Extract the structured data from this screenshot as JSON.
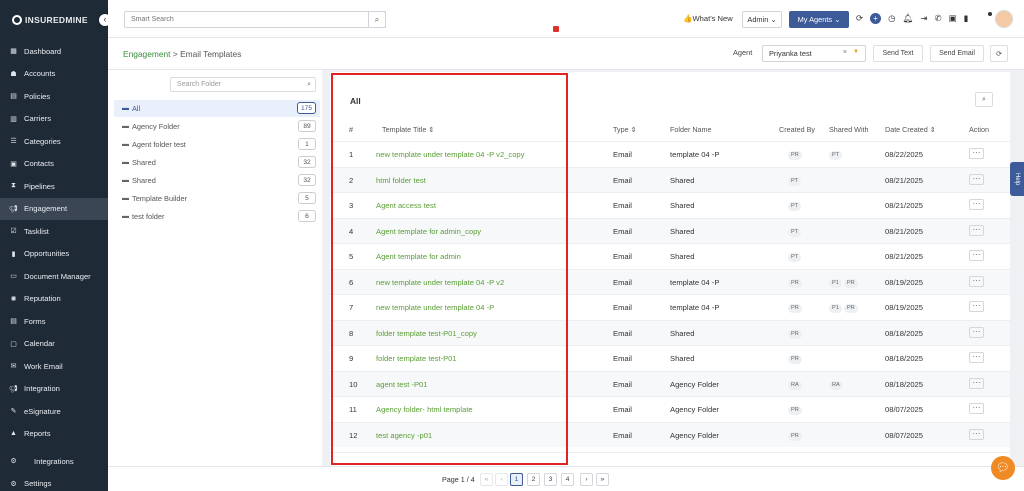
{
  "brand": {
    "logo_text": "INSUREDMINE"
  },
  "sidebar": {
    "collapse_icon": "chevron-left-icon",
    "items": [
      {
        "label": "Dashboard",
        "icon": "dashboard-icon"
      },
      {
        "label": "Accounts",
        "icon": "accounts-icon"
      },
      {
        "label": "Policies",
        "icon": "policies-icon"
      },
      {
        "label": "Carriers",
        "icon": "carriers-icon"
      },
      {
        "label": "Categories",
        "icon": "categories-icon"
      },
      {
        "label": "Contacts",
        "icon": "contacts-icon"
      },
      {
        "label": "Pipelines",
        "icon": "pipelines-icon"
      },
      {
        "label": "Engagement",
        "icon": "megaphone-icon",
        "active": true
      },
      {
        "label": "Tasklist",
        "icon": "tasklist-icon"
      },
      {
        "label": "Opportunities",
        "icon": "bar-chart-icon"
      },
      {
        "label": "Document Manager",
        "icon": "folder-icon"
      },
      {
        "label": "Reputation",
        "icon": "reputation-icon"
      },
      {
        "label": "Forms",
        "icon": "forms-icon"
      },
      {
        "label": "Calendar",
        "icon": "calendar-icon"
      },
      {
        "label": "Work Email",
        "icon": "email-icon"
      },
      {
        "label": "Integration",
        "icon": "megaphone-icon"
      },
      {
        "label": "eSignature",
        "icon": "signature-icon"
      },
      {
        "label": "Reports",
        "icon": "reports-icon"
      },
      {
        "label": "Integrations",
        "icon": "gears-icon"
      },
      {
        "label": "Settings",
        "icon": "gear-icon"
      }
    ]
  },
  "topbar": {
    "search_placeholder": "Smart Search",
    "whats_new": "What's New",
    "admin_label": "Admin",
    "my_agents_label": "My Agents"
  },
  "breadcrumb": {
    "parent": "Engagement",
    "separator": ">",
    "current": "Email Templates"
  },
  "agent": {
    "label": "Agent",
    "selected": "Priyanka test",
    "send_text_label": "Send Text",
    "send_email_label": "Send Email"
  },
  "folders": {
    "search_placeholder": "Search Folder",
    "items": [
      {
        "name": "All",
        "count": "175",
        "selected": true
      },
      {
        "name": "Agency Folder",
        "count": "89"
      },
      {
        "name": "Agent folder test",
        "count": "1"
      },
      {
        "name": "Shared",
        "count": "32"
      },
      {
        "name": "Shared",
        "count": "32"
      },
      {
        "name": "Template Builder",
        "count": "5"
      },
      {
        "name": "test folder",
        "count": "6"
      }
    ]
  },
  "table": {
    "title": "All",
    "columns": {
      "num": "#",
      "title": "Template Title",
      "type": "Type",
      "folder": "Folder Name",
      "created_by": "Created By",
      "shared_with": "Shared With",
      "date": "Date Created",
      "action": "Action"
    },
    "rows": [
      {
        "num": "1",
        "title": "new template under template 04 -P v2_copy",
        "type": "Email",
        "folder": "template 04 -P",
        "created_by": "PR",
        "shared_with": "PT",
        "date": "08/22/2025"
      },
      {
        "num": "2",
        "title": "html folder test",
        "type": "Email",
        "folder": "Shared",
        "created_by": "PT",
        "shared_with": "",
        "date": "08/21/2025"
      },
      {
        "num": "3",
        "title": "Agent access test",
        "type": "Email",
        "folder": "Shared",
        "created_by": "PT",
        "shared_with": "",
        "date": "08/21/2025"
      },
      {
        "num": "4",
        "title": "Agent template for admin_copy",
        "type": "Email",
        "folder": "Shared",
        "created_by": "PT",
        "shared_with": "",
        "date": "08/21/2025"
      },
      {
        "num": "5",
        "title": "Agent template for admin",
        "type": "Email",
        "folder": "Shared",
        "created_by": "PT",
        "shared_with": "",
        "date": "08/21/2025"
      },
      {
        "num": "6",
        "title": "new template under template 04 -P v2",
        "type": "Email",
        "folder": "template 04 -P",
        "created_by": "PR",
        "shared_with": "P1 PR",
        "date": "08/19/2025"
      },
      {
        "num": "7",
        "title": "new template under template 04 -P",
        "type": "Email",
        "folder": "template 04 -P",
        "created_by": "PR",
        "shared_with": "P1 PR",
        "date": "08/19/2025"
      },
      {
        "num": "8",
        "title": "folder template test-P01_copy",
        "type": "Email",
        "folder": "Shared",
        "created_by": "PR",
        "shared_with": "",
        "date": "08/18/2025"
      },
      {
        "num": "9",
        "title": "folder template test-P01",
        "type": "Email",
        "folder": "Shared",
        "created_by": "PR",
        "shared_with": "",
        "date": "08/18/2025"
      },
      {
        "num": "10",
        "title": "agent test -P01",
        "type": "Email",
        "folder": "Agency Folder",
        "created_by": "RA",
        "shared_with": "RA",
        "date": "08/18/2025"
      },
      {
        "num": "11",
        "title": "Agency folder- html template",
        "type": "Email",
        "folder": "Agency Folder",
        "created_by": "PR",
        "shared_with": "",
        "date": "08/07/2025"
      },
      {
        "num": "12",
        "title": "test agency -p01",
        "type": "Email",
        "folder": "Agency Folder",
        "created_by": "PR",
        "shared_with": "",
        "date": "08/07/2025"
      }
    ],
    "row_action_label": "···"
  },
  "pagination": {
    "page_text": "Page 1 / 4",
    "first": "«",
    "prev": "‹",
    "pages": [
      "1",
      "2",
      "3",
      "4"
    ],
    "current": "1",
    "next": "›",
    "last": "»"
  },
  "help_tab": "Help",
  "colors": {
    "sidebar_bg": "#1f2a37",
    "accent": "#3d5a99",
    "link_green": "#5a9e35",
    "highlight_red": "#e02323",
    "chat_orange": "#f08a24"
  }
}
